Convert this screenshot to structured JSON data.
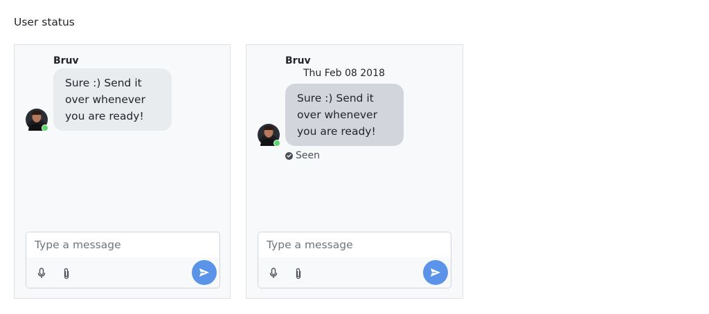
{
  "page": {
    "title": "User status"
  },
  "chats": [
    {
      "sender": "Bruv",
      "timestamp": "",
      "message": "Sure :) Send it over whenever you are ready!",
      "seen_label": "",
      "input_placeholder": "Type a message"
    },
    {
      "sender": "Bruv",
      "timestamp": "Thu Feb 08 2018",
      "message": "Sure :) Send it over whenever you are ready!",
      "seen_label": "Seen",
      "input_placeholder": "Type a message"
    }
  ],
  "icons": {
    "mic": "microphone-icon",
    "attach": "paperclip-icon",
    "send": "paper-plane-icon",
    "seen": "check-circle-icon"
  },
  "colors": {
    "online": "#5cd66b",
    "send_button": "#5b93e9",
    "bubble_1": "#e9ecef",
    "bubble_2": "#d2d6dc",
    "panel_bg": "#f8f9fa"
  }
}
